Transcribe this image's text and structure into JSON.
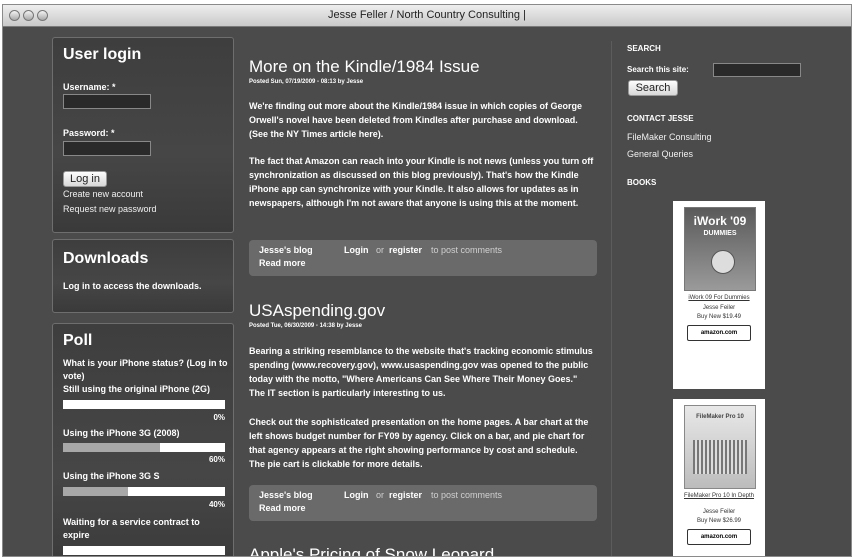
{
  "window": {
    "title": "Jesse Feller / North Country Consulting |"
  },
  "user_login": {
    "heading": "User login",
    "username_label": "Username: *",
    "password_label": "Password: *",
    "login_button": "Log in",
    "create_account": "Create new account",
    "request_password": "Request new password"
  },
  "downloads": {
    "heading": "Downloads",
    "text": "Log in to access the downloads."
  },
  "poll": {
    "heading": "Poll",
    "question": "What is your iPhone status? (Log in to vote)",
    "choices": [
      {
        "label": "Still using the original iPhone (2G)",
        "percent_text": "0%",
        "value": 0
      },
      {
        "label": "Using the iPhone 3G (2008)",
        "percent_text": "60%",
        "value": 0.6
      },
      {
        "label": "Using the iPhone 3G S",
        "percent_text": "40%",
        "value": 0.4
      },
      {
        "label": "Waiting for a service contract to expire",
        "percent_text": "",
        "value": 0
      }
    ]
  },
  "posts": [
    {
      "title": "More on the Kindle/1984 Issue",
      "posted": "Posted Sun, 07/19/2009 - 08:13 by Jesse",
      "paragraphs": [
        "We're finding out more about the Kindle/1984 issue in which copies of George Orwell's novel have been deleted from Kindles after purchase and download. (See the NY Times article here).",
        "The fact that Amazon can reach into your Kindle is not news (unless you turn off synchronization as discussed on this blog previously). That's how the Kindle iPhone app can synchronize with your Kindle. It also allows for updates as in newspapers, although I'm not aware that anyone is using this at the moment."
      ],
      "links": {
        "blog": "Jesse's blog",
        "login": "Login",
        "or": "or",
        "register": "register",
        "to_post": "to post comments",
        "read_more": "Read more"
      }
    },
    {
      "title": "USAspending.gov",
      "posted": "Posted Tue, 06/30/2009 - 14:38 by Jesse",
      "paragraphs": [
        "Bearing a striking resemblance to the website that's tracking economic stimulus spending (www.recovery.gov), www.usaspending.gov was opened to the public today with the motto, \"Where Americans Can See Where Their Money Goes.\" The IT section is particularly interesting to us.",
        "Check out the sophisticated presentation on the home pages. A bar chart at the left shows budget number for FY09 by agency. Click on a bar, and pie chart for that agency appears at the right showing performance by cost and schedule. The pie cart is clickable for more details."
      ],
      "links": {
        "blog": "Jesse's blog",
        "login": "Login",
        "or": "or",
        "register": "register",
        "to_post": "to post comments",
        "read_more": "Read more"
      }
    },
    {
      "title": "Apple's Pricing of Snow Leopard"
    }
  ],
  "sidebar_right": {
    "search_heading": "SEARCH",
    "search_label": "Search this site:",
    "search_button": "Search",
    "contact_heading": "CONTACT JESSE",
    "contact_links": [
      "FileMaker Consulting",
      "General Queries"
    ],
    "books_heading": "BOOKS",
    "books": [
      {
        "cover_title": "iWork '09",
        "cover_sub": "DUMMIES",
        "link": "iWork 09 For Dummies",
        "author": "Jesse Feiler",
        "price": "Buy New $19.49",
        "amazon": "amazon.com"
      },
      {
        "cover_title": "FileMaker Pro 10",
        "cover_sub": "",
        "link": "FileMaker Pro 10 In Depth",
        "author": "Jesse Feiler",
        "price": "Buy New $26.99",
        "amazon": "amazon.com"
      }
    ]
  },
  "colors": {
    "background": "#4b4b4b",
    "panel": "#3f3f3f",
    "link_bar": "#6a6a6a"
  }
}
